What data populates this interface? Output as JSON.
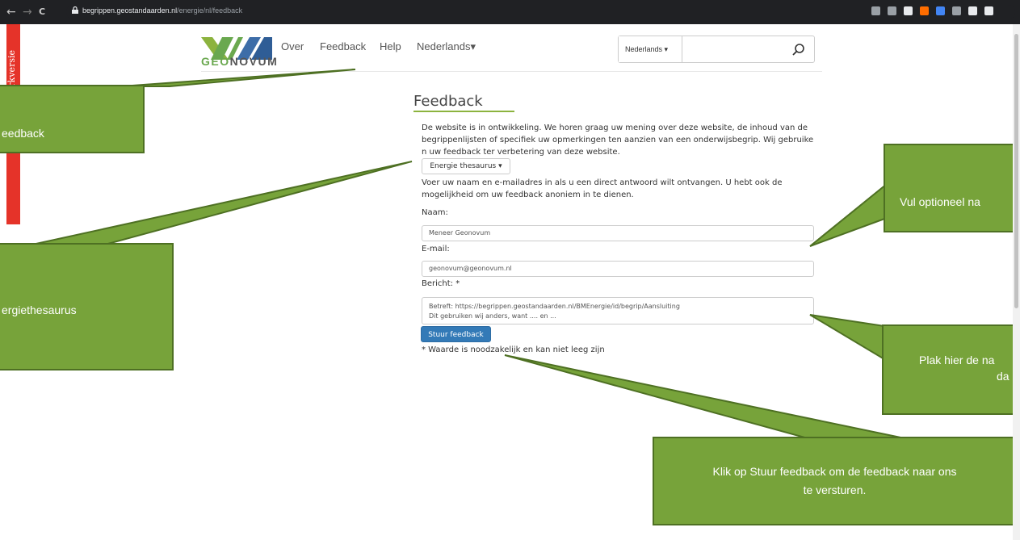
{
  "browser": {
    "url_host": "begrippen.geostandaarden.nl",
    "url_path": "/energie/nl/feedback",
    "back_glyph": "←",
    "forward_glyph": "→",
    "reload_glyph": "C",
    "extension_colors": [
      "#9aa0a6",
      "#9aa0a6",
      "#e8eaed",
      "#ff6d00",
      "#4285f4",
      "#9aa0a6",
      "#e8eaed",
      "#e8eaed"
    ]
  },
  "sidebar_banner": {
    "label": "Werkversie",
    "color": "#e53329"
  },
  "header": {
    "logo_geo": "GEO",
    "logo_novum": "NOVUM",
    "nav": [
      "Over",
      "Feedback",
      "Help",
      "Nederlands▾"
    ],
    "search": {
      "language": "Nederlands ▾",
      "placeholder": ""
    }
  },
  "main": {
    "title": "Feedback",
    "intro": "De website is in ontwikkeling. We horen graag uw mening over deze website, de inhoud van de begrippenlijsten of specifiek uw opmerkingen ten aanzien van een onderwijsbegrip. Wij gebruiken uw feedback ter verbetering van deze website.",
    "thesaurus_dropdown": "Energie thesaurus ▾",
    "instructions": "Voer uw naam en e-mailadres in als u een direct antwoord wilt ontvangen. U hebt ook de mogelijkheid om uw feedback anoniem in te dienen.",
    "name_label": "Naam:",
    "name_value": "Meneer Geonovum",
    "email_label": "E-mail:",
    "email_value": "geonovum@geonovum.nl",
    "message_label": "Bericht: *",
    "message_line1": "Betreft: https://begrippen.geostandaarden.nl/BMEnergie/id/begrip/Aansluiting",
    "message_line2": "Dit gebruiken wij anders, want .... en ...",
    "submit_label": "Stuur feedback",
    "required_note": "* Waarde is noodzakelijk en kan niet leeg zijn"
  },
  "callouts": {
    "feedback": "eedback",
    "thesaurus": "ergiethesaurus",
    "name_hint": "Vul optioneel na",
    "paste_hint_1": "Plak hier de na",
    "paste_hint_2": "da",
    "submit_hint_1": "Klik op Stuur feedback om de feedback naar ons",
    "submit_hint_2": "te versturen.",
    "fill": "#77a33a",
    "border": "#4e7023"
  }
}
